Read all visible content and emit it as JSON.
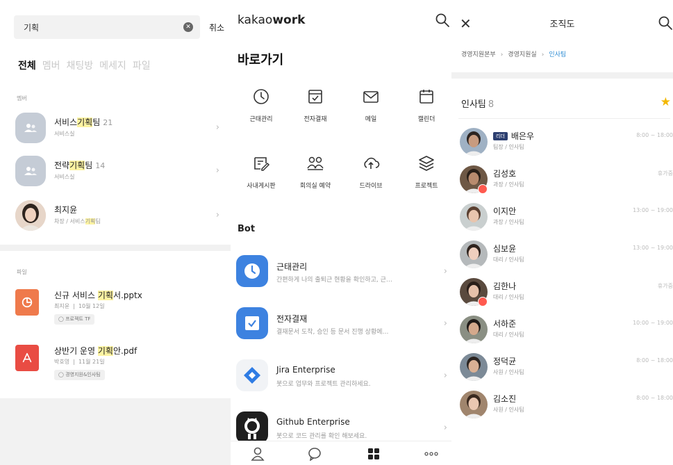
{
  "search_panel": {
    "query": "기획",
    "cancel_label": "취소",
    "tabs": [
      "전체",
      "멤버",
      "채팅방",
      "메세지",
      "파일"
    ],
    "member_section_label": "멤버",
    "members": [
      {
        "pre": "서비스",
        "hl": "기획",
        "post": "팀",
        "count": "21",
        "sub_pre": "서비스실",
        "sub_hl": "",
        "sub_post": ""
      },
      {
        "pre": "전략",
        "hl": "기획",
        "post": "팀",
        "count": "14",
        "sub_pre": "서비스실",
        "sub_hl": "",
        "sub_post": ""
      },
      {
        "pre": "최지윤",
        "hl": "",
        "post": "",
        "count": "",
        "sub_pre": "차장 / 서비스",
        "sub_hl": "기획",
        "sub_post": "팀"
      }
    ],
    "file_section_label": "파일",
    "files": [
      {
        "pre": "신규 서비스 ",
        "hl": "기획",
        "post": "서.pptx",
        "author": "최지윤",
        "date": "10월 12일",
        "tag": "프로젝트 TF",
        "color": "#ef7a4c"
      },
      {
        "pre": "상반기 운영 ",
        "hl": "기획",
        "post": "안.pdf",
        "author": "박호영",
        "date": "11월 21일",
        "tag": "경영지원&인사팀",
        "color": "#e94c43"
      }
    ]
  },
  "home_panel": {
    "logo_light": "kakao",
    "logo_bold": "work",
    "heading": "바로가기",
    "shortcuts": [
      {
        "icon": "clock-icon",
        "label": "근태관리"
      },
      {
        "icon": "approval-icon",
        "label": "전자결재"
      },
      {
        "icon": "mail-icon",
        "label": "메일"
      },
      {
        "icon": "calendar-icon",
        "label": "캘린더"
      },
      {
        "icon": "board-icon",
        "label": "사내게시판"
      },
      {
        "icon": "meeting-room-icon",
        "label": "회의실 예약"
      },
      {
        "icon": "cloud-icon",
        "label": "드라이브"
      },
      {
        "icon": "layers-icon",
        "label": "프로젝트"
      }
    ],
    "bot_heading": "Bot",
    "bots": [
      {
        "icon": "clock-bot-icon",
        "name": "근태관리",
        "desc": "간편하게 나의 출퇴근 현황을 확인하고, 근…",
        "color": "#3d82e0"
      },
      {
        "icon": "approval-bot-icon",
        "name": "전자결재",
        "desc": "결재문서 도착, 승인 등 문서 진행 상황에…",
        "color": "#3d82e0"
      },
      {
        "icon": "jira-icon",
        "name": "Jira Enterprise",
        "desc": "봇으로 업무와 프로젝트 관리하세요.",
        "color": "#f1f3f6"
      },
      {
        "icon": "github-icon",
        "name": "Github Enterprise",
        "desc": "봇으로 코드 관리를 확인 해보세요.",
        "color": "#1f1f1f"
      }
    ],
    "nav": [
      "person-icon",
      "chat-bubble-icon",
      "grid-icon",
      "more-icon"
    ]
  },
  "org_panel": {
    "title": "조직도",
    "breadcrumbs": [
      "경영지원본부",
      "경영지원실",
      "인사팀"
    ],
    "team_name": "인사팀",
    "team_count": "8",
    "leader_badge": "리더",
    "people": [
      {
        "name": "배은우",
        "role": "팀장 / 인사팀",
        "time": "8:00 ~ 18:00",
        "leader": true,
        "away": false,
        "skin": "#c89b7f",
        "hair": "#2c2420",
        "bg": "#9fb1c4"
      },
      {
        "name": "김성호",
        "role": "과장 / 인사팀",
        "time": "휴가중",
        "leader": false,
        "away": true,
        "skin": "#b88b6e",
        "hair": "#2a2019",
        "bg": "#6e5845"
      },
      {
        "name": "이지안",
        "role": "과장 / 인사팀",
        "time": "13:00 ~ 19:00",
        "leader": false,
        "away": false,
        "skin": "#e8c5ae",
        "hair": "#5a3f30",
        "bg": "#c9cfcf"
      },
      {
        "name": "심보윤",
        "role": "대리 / 인사팀",
        "time": "13:00 ~ 19:00",
        "leader": false,
        "away": false,
        "skin": "#efcfbe",
        "hair": "#2e231e",
        "bg": "#b5b9bb"
      },
      {
        "name": "김한나",
        "role": "대리 / 인사팀",
        "time": "휴가중",
        "leader": false,
        "away": true,
        "skin": "#e6c1aa",
        "hair": "#2a1f19",
        "bg": "#5a4a3e"
      },
      {
        "name": "서하준",
        "role": "대리 / 인사팀",
        "time": "10:00 ~ 19:00",
        "leader": false,
        "away": false,
        "skin": "#d4a98c",
        "hair": "#1f1a17",
        "bg": "#8a8f83"
      },
      {
        "name": "정덕균",
        "role": "사원 / 인사팀",
        "time": "8:00 ~ 18:00",
        "leader": false,
        "away": false,
        "skin": "#d9b094",
        "hair": "#2b2420",
        "bg": "#7c8a97"
      },
      {
        "name": "김소진",
        "role": "사원 / 인사팀",
        "time": "8:00 ~ 18:00",
        "leader": false,
        "away": false,
        "skin": "#eac7b1",
        "hair": "#3a2a20",
        "bg": "#a0856d"
      }
    ]
  }
}
